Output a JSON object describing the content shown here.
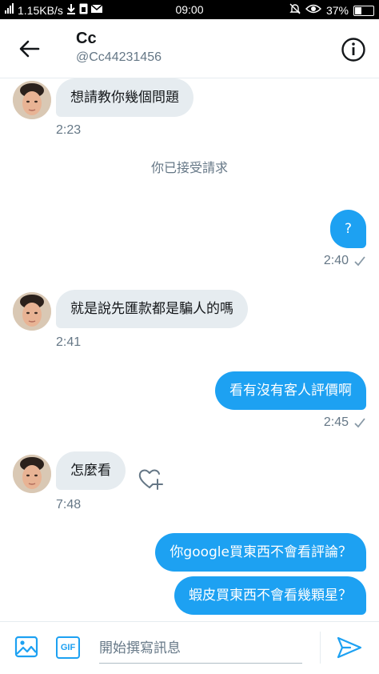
{
  "status_bar": {
    "network_speed": "1.15KB/s",
    "time": "09:00",
    "battery_percent": "37%",
    "battery_level": 0.37
  },
  "header": {
    "name": "Cc",
    "handle": "@Cc44231456"
  },
  "messages": [
    {
      "text": "想請教你幾個問題",
      "time": "2:23"
    },
    {
      "text": "你已接受請求"
    },
    {
      "text": "?",
      "time": "2:40"
    },
    {
      "text": "就是說先匯款都是騙人的嗎",
      "time": "2:41"
    },
    {
      "text": "看有沒有客人評價啊",
      "time": "2:45"
    },
    {
      "text": "怎麼看",
      "time": "7:48"
    },
    {
      "text": "你google買東西不會看評論？"
    },
    {
      "text": "蝦皮買東西不會看幾顆星？"
    }
  ],
  "composer": {
    "placeholder": "開始撰寫訊息",
    "gif_label": "GIF"
  },
  "colors": {
    "accent": "#1da1f2",
    "incoming_bubble": "#e6ecf0",
    "secondary_text": "#657786"
  },
  "icons": [
    "back-arrow-icon",
    "info-icon",
    "heart-add-icon",
    "image-icon",
    "send-icon",
    "check-icon"
  ]
}
